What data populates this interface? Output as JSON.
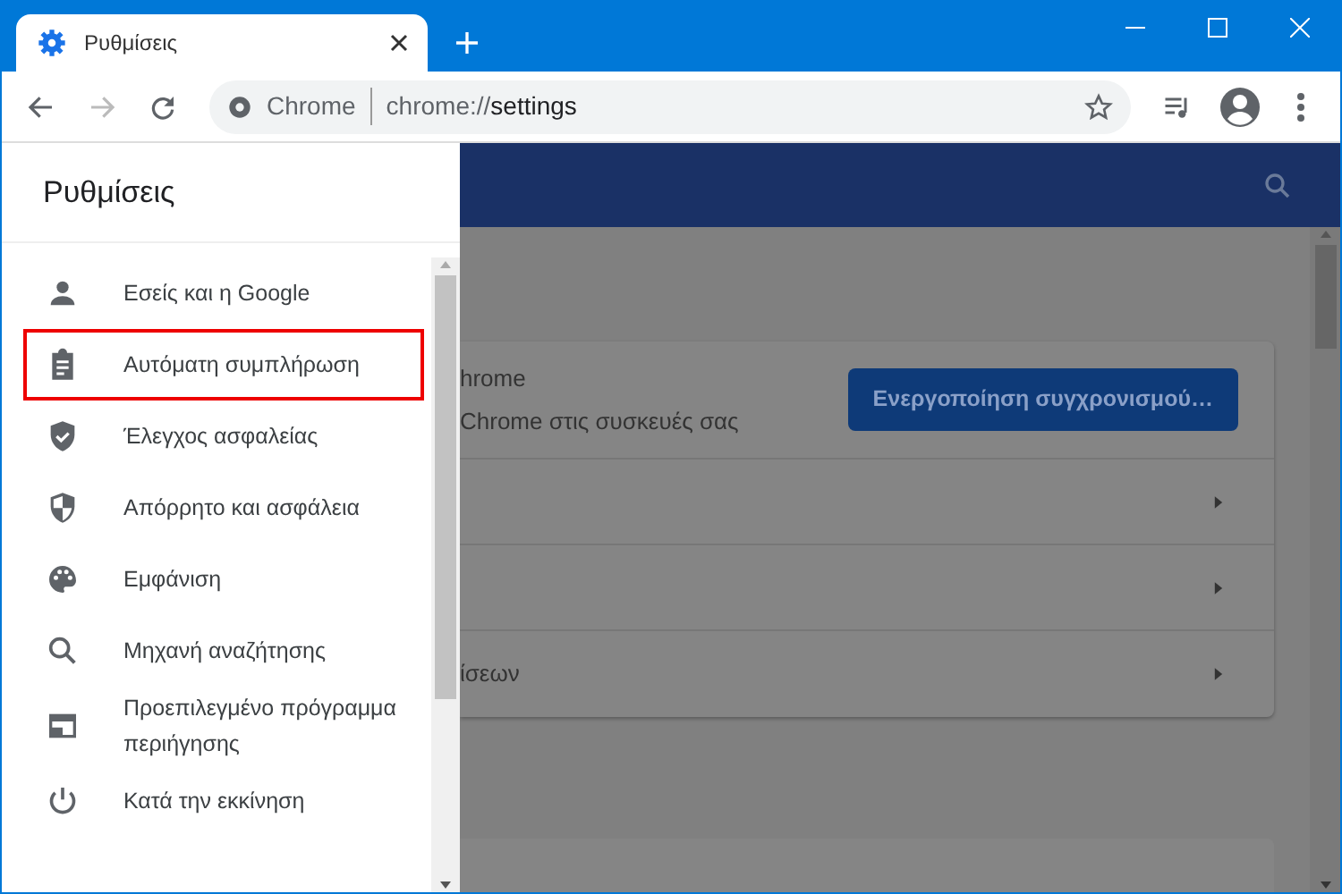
{
  "window": {
    "tab_title": "Ρυθμίσεις"
  },
  "toolbar": {
    "omnibox_site": "Chrome",
    "url_scheme": "chrome://",
    "url_path": "settings"
  },
  "drawer": {
    "title": "Ρυθμίσεις",
    "items": [
      {
        "label": "Εσείς και η Google",
        "highlighted": false
      },
      {
        "label": "Αυτόματη συμπλήρωση",
        "highlighted": true
      },
      {
        "label": "Έλεγχος ασφαλείας",
        "highlighted": false
      },
      {
        "label": "Απόρρητο και ασφάλεια",
        "highlighted": false
      },
      {
        "label": "Εμφάνιση",
        "highlighted": false
      },
      {
        "label": "Μηχανή αναζήτησης",
        "highlighted": false
      },
      {
        "label": "Προεπιλεγμένο πρόγραμμα περιήγησης",
        "highlighted": false
      },
      {
        "label": "Κατά την εκκίνηση",
        "highlighted": false
      }
    ]
  },
  "sync_card": {
    "title": "hrome",
    "subtitle": "Chrome στις συσκευές σας",
    "button": "Ενεργοποίηση συγχρονισμού…",
    "rows": [
      {
        "kind": "link"
      },
      {
        "kind": "link"
      },
      {
        "kind": "link",
        "label": "ίσεων"
      }
    ]
  }
}
